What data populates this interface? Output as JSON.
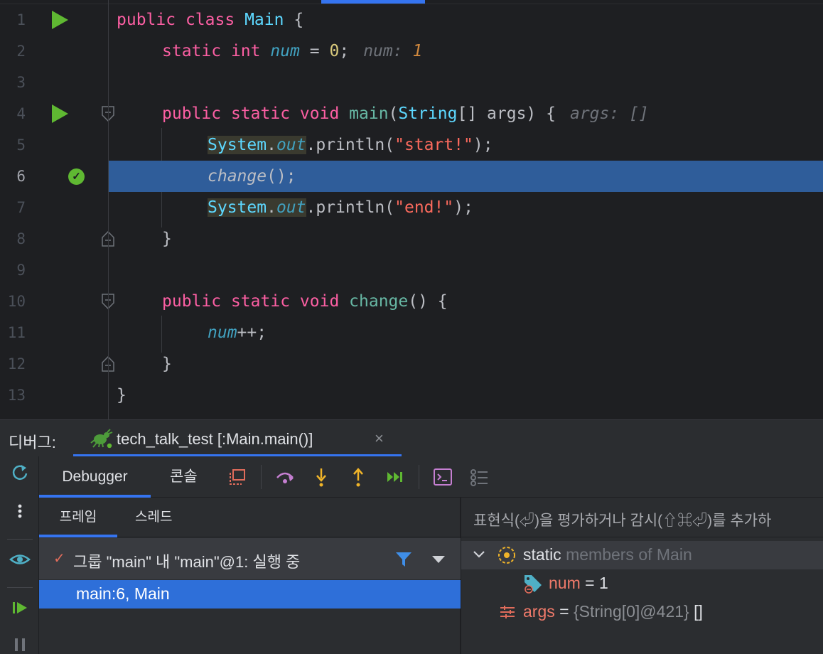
{
  "editor": {
    "lines": [
      {
        "n": "1"
      },
      {
        "n": "2"
      },
      {
        "n": "3"
      },
      {
        "n": "4"
      },
      {
        "n": "5"
      },
      {
        "n": "6"
      },
      {
        "n": "7"
      },
      {
        "n": "8"
      },
      {
        "n": "9"
      },
      {
        "n": "10"
      },
      {
        "n": "11"
      },
      {
        "n": "12"
      },
      {
        "n": "13"
      }
    ],
    "tokens": {
      "l1": {
        "kw1": "public",
        "kw2": "class",
        "cls": "Main",
        "rest": "{"
      },
      "l2": {
        "kw1": "static",
        "kw2": "int",
        "fld": "num",
        "eq": "=",
        "val": "0",
        "semi": ";",
        "hint_label": "num:",
        "hint_value": "1"
      },
      "l4": {
        "kw1": "public",
        "kw2": "static",
        "kw3": "void",
        "mth": "main",
        "p1": "(",
        "cls": "String",
        "rest": "[] args) {",
        "hint": "args: []"
      },
      "l5": {
        "cls": "System",
        "dot1": ".",
        "fld": "out",
        "call": ".println(",
        "str": "\"start!\"",
        "end": ");"
      },
      "l6": {
        "call": "change",
        "end": "();"
      },
      "l7": {
        "cls": "System",
        "dot1": ".",
        "fld": "out",
        "call": ".println(",
        "str": "\"end!\"",
        "end": ");"
      },
      "l8": {
        "rest": "}"
      },
      "l10": {
        "kw1": "public",
        "kw2": "static",
        "kw3": "void",
        "mth": "change",
        "rest": "() {"
      },
      "l11": {
        "fld": "num",
        "rest": "++;"
      },
      "l12": {
        "rest": "}"
      },
      "l13": {
        "rest": "}"
      }
    },
    "current_line": 6
  },
  "debug_window": {
    "label": "디버그:",
    "run_tab": "tech_talk_test [:Main.main()]",
    "close_glyph": "×"
  },
  "toolbar": {
    "tabs": [
      "Debugger",
      "콘솔"
    ],
    "icons": [
      "restore-layout-icon",
      "step-over-icon",
      "step-into-icon",
      "step-out-icon",
      "run-to-cursor-icon",
      "evaluate-icon",
      "more-icon"
    ]
  },
  "frames": {
    "tabs": [
      "프레임",
      "스레드"
    ],
    "thread": "그룹 \"main\" 내 \"main\"@1: 실행 중",
    "check_glyph": "✓",
    "selected_frame": "main:6, Main"
  },
  "variables": {
    "eval_placeholder": "표현식(⏎)을 평가하거나 감시(⇧⌘⏎)를 추가하",
    "static_row": {
      "name": "static",
      "desc": "members of Main"
    },
    "num_row": {
      "name": "num",
      "eq": "=",
      "value": "1"
    },
    "args_row": {
      "name": "args",
      "eq": "=",
      "value": "{String[0]@421}",
      "extra": "[]"
    }
  },
  "colors": {
    "editor_bg": "#1e1f22",
    "panel_bg": "#2b2d30",
    "accent": "#3574f0",
    "current_line": "#2f5d9a",
    "selected_frame": "#2e6fd9",
    "run_green": "#5fb832"
  }
}
